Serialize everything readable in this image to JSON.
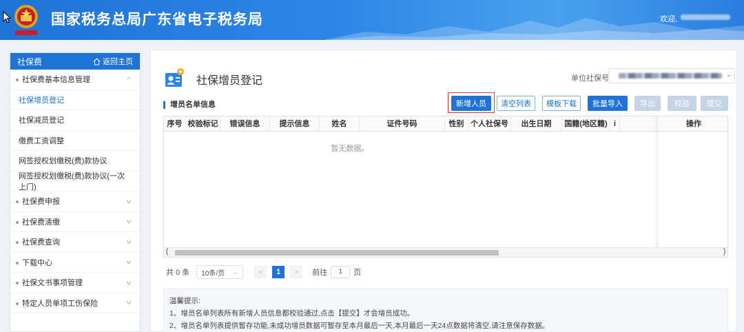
{
  "header": {
    "site_title": "国家税务总局广东省电子税务局",
    "welcome": "欢迎,"
  },
  "sidebar": {
    "title": "社保费",
    "home_link": "返回主页",
    "items": [
      {
        "label": "社保费基本信息管理",
        "type": "group",
        "expanded": true
      },
      {
        "label": "社保增员登记",
        "type": "sub",
        "active": true
      },
      {
        "label": "社保减员登记",
        "type": "sub"
      },
      {
        "label": "缴费工资调整",
        "type": "sub"
      },
      {
        "label": "网签授权划缴税(费)款协议",
        "type": "sub"
      },
      {
        "label": "网签授权划缴税(费)款协议(一次上门)",
        "type": "sub"
      },
      {
        "label": "社保费申报",
        "type": "group"
      },
      {
        "label": "社保费清缴",
        "type": "group"
      },
      {
        "label": "社保费查询",
        "type": "group"
      },
      {
        "label": "下载中心",
        "type": "group"
      },
      {
        "label": "社保文书事项管理",
        "type": "group"
      },
      {
        "label": "特定人员单项工伤保险",
        "type": "group"
      }
    ]
  },
  "main": {
    "page_title": "社保增员登记",
    "unit_label": "单位社保号:",
    "section_label": "增员名单信息",
    "buttons": {
      "add": "新增人员",
      "clear": "清空列表",
      "template": "模板下载",
      "import": "批量导入",
      "export": "导出",
      "verify": "校验",
      "submit": "提交"
    },
    "table": {
      "columns": [
        "序号",
        "校验标记",
        "错误信息",
        "提示信息",
        "姓名",
        "证件号码",
        "性别",
        "个人社保号",
        "出生日期",
        "国籍(地区籍)",
        "i"
      ],
      "action_column": "操作",
      "empty_text": "暂无数据。"
    },
    "pager": {
      "total": "共 0 条",
      "page_size": "10条/页",
      "current_page": "1",
      "goto_label": "前往",
      "goto_value": "1",
      "page_suffix": "页"
    },
    "tips": {
      "title": "温馨提示:",
      "line1": "1、增员名单列表所有新增人员信息都校验通过,点击【提交】才会增员成功。",
      "line2": "2、增员名单列表提供暂存功能,未成功增员数据可暂存至本月最后一天,本月最后一天24点数据将清空,请注意保存数据。"
    }
  },
  "colors": {
    "header_blue": "#1f73d6",
    "accent_blue": "#1f73d6",
    "highlight_red": "#e53333",
    "disabled_button": "#c5d3e6"
  }
}
